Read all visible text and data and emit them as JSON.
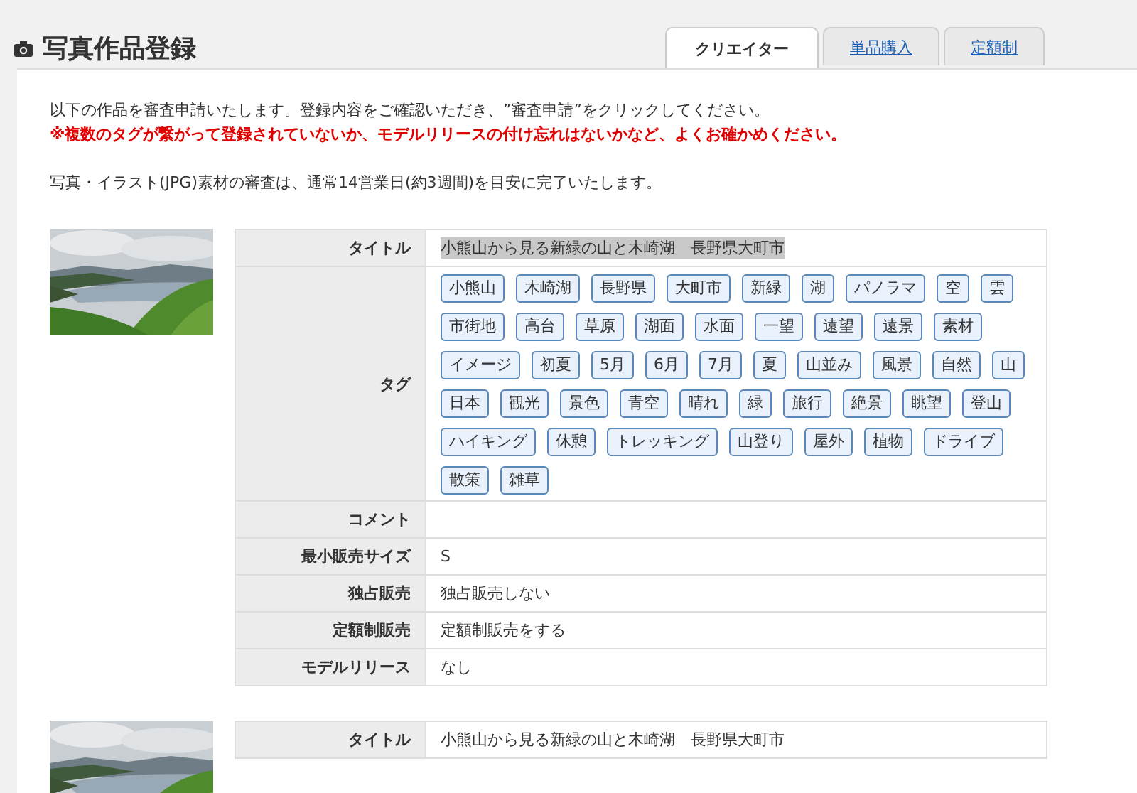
{
  "header": {
    "title": "写真作品登録"
  },
  "tabs": [
    {
      "label": "クリエイター",
      "selected": true
    },
    {
      "label": "単品購入",
      "selected": false
    },
    {
      "label": "定額制",
      "selected": false
    }
  ],
  "intro": {
    "lines": [
      {
        "text": "以下の作品を審査申請いたします。登録内容をご確認いただき、”審査申請”をクリックしてください。",
        "kind": "normal"
      },
      {
        "text": "※複数のタグが繋がって登録されていないか、モデルリリースの付け忘れはないかなど、よくお確かめください。",
        "kind": "warning"
      }
    ],
    "note": "写真・イラスト(JPG)素材の審査は、通常14営業日(約3週間)を目安に完了いたします。"
  },
  "works": [
    {
      "thumbnail": {
        "kind": "picture"
      },
      "rows": [
        {
          "kind": "title",
          "label": "タイトル",
          "value": "小熊山から見る新緑の山と木崎湖　長野県大町市",
          "selected": true
        },
        {
          "kind": "tags",
          "label": "タグ",
          "tags": [
            "小熊山",
            "木崎湖",
            "長野県",
            "大町市",
            "新緑",
            "湖",
            "パノラマ",
            "空",
            "雲",
            "市街地",
            "高台",
            "草原",
            "湖面",
            "水面",
            "一望",
            "遠望",
            "遠景",
            "素材",
            "イメージ",
            "初夏",
            "5月",
            "6月",
            "7月",
            "夏",
            "山並み",
            "風景",
            "自然",
            "山",
            "日本",
            "観光",
            "景色",
            "青空",
            "晴れ",
            "緑",
            "旅行",
            "絶景",
            "眺望",
            "登山",
            "ハイキング",
            "休憩",
            "トレッキング",
            "山登り",
            "屋外",
            "植物",
            "ドライブ",
            "散策",
            "雑草"
          ]
        },
        {
          "kind": "text",
          "label": "コメント",
          "value": ""
        },
        {
          "kind": "text",
          "label": "最小販売サイズ",
          "value": "S"
        },
        {
          "kind": "text",
          "label": "独占販売",
          "value": "独占販売しない"
        },
        {
          "kind": "text",
          "label": "定額制販売",
          "value": "定額制販売をする"
        },
        {
          "kind": "text",
          "label": "モデルリリース",
          "value": "なし"
        }
      ]
    },
    {
      "thumbnail": {
        "kind": "picture"
      },
      "rows": [
        {
          "kind": "title",
          "label": "タイトル",
          "value": "小熊山から見る新緑の山と木崎湖　長野県大町市",
          "selected": false
        }
      ]
    }
  ]
}
